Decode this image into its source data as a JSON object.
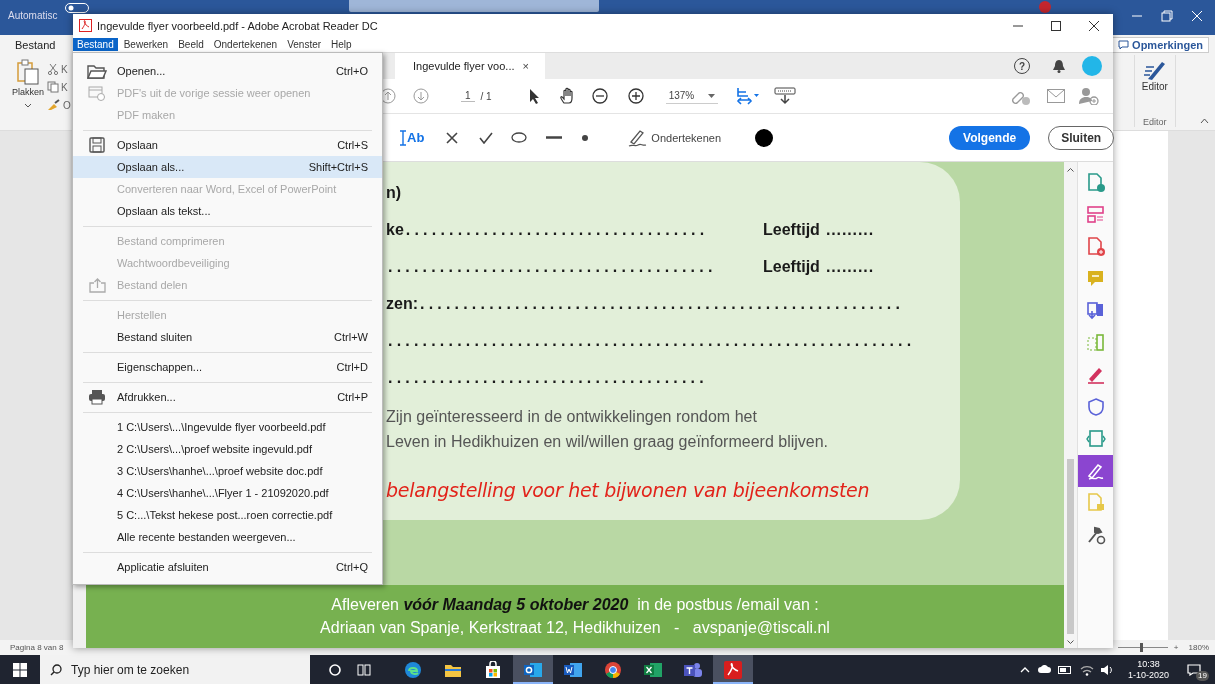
{
  "word": {
    "title_fragment": "Automatisc",
    "tab": "Bestand",
    "paste": "Plakken",
    "cut_fragment": "K",
    "copy_fragment": "K",
    "format_fragment": "O",
    "comments_button": "Opmerkingen",
    "editor_button": "Editor",
    "editor_group": "Editor",
    "status": "Pagina 8 van 8",
    "zoom": {
      "level": 0.45,
      "plus": "+",
      "reading": "180%"
    }
  },
  "acrobat": {
    "title": "Ingevulde flyer voorbeeld.pdf - Adobe Acrobat Reader DC",
    "menubar": [
      {
        "label": "Bestand",
        "selected": true
      },
      {
        "label": "Bewerken",
        "selected": false
      },
      {
        "label": "Beeld",
        "selected": false
      },
      {
        "label": "Ondertekenen",
        "selected": false
      },
      {
        "label": "Venster",
        "selected": false
      },
      {
        "label": "Help",
        "selected": false
      }
    ],
    "doc_tab": {
      "label": "Ingevulde flyer voo...",
      "close": "×"
    },
    "help": "?",
    "toolbar": {
      "page": "1",
      "page_count": "/ 1",
      "zoom": "137%"
    },
    "fill_sign": {
      "text_tool": "Ab",
      "sign": "Ondertekenen",
      "next": "Volgende",
      "close": "Sluiten"
    },
    "document": {
      "form_rows": [
        {
          "label": "n)"
        },
        {
          "label": "ke",
          "line": "...................................",
          "age_label": "Leeftijd",
          "age_line": "........."
        },
        {
          "line": "......................................",
          "age_label": "Leeftijd",
          "age_line": "........."
        },
        {
          "label": "zen:",
          "line": "........................................................"
        },
        {
          "line": "............................................................."
        },
        {
          "line": "....................................."
        }
      ],
      "note_lines": [
        "Zijn geïnteresseerd in de ontwikkelingen rondom het",
        "Leven in Hedikhuizen en wil/willen graag geïnformeerd blijven."
      ],
      "red_line": "belangstelling voor het bijwonen van bijeenkomsten",
      "footer": [
        "Afleveren **vóór Maandag 5 oktober 2020**  in de postbus /email van :",
        "Adriaan van Spanje, Kerkstraat 12, Hedikhuizen   -   avspanje@tiscali.nl"
      ]
    },
    "rail": [
      {
        "kind": "doc-badge",
        "selected": false
      },
      {
        "kind": "layout",
        "selected": false
      },
      {
        "kind": "doc-plus",
        "selected": false
      },
      {
        "kind": "comment",
        "selected": false
      },
      {
        "kind": "export",
        "selected": false
      },
      {
        "kind": "crop",
        "selected": false
      },
      {
        "kind": "pen",
        "selected": false
      },
      {
        "kind": "shield",
        "selected": false
      },
      {
        "kind": "doc-code",
        "selected": false
      },
      {
        "kind": "sign",
        "selected": true
      },
      {
        "kind": "doc-lines",
        "selected": false
      },
      {
        "kind": "wrench",
        "selected": false
      }
    ],
    "file_menu": [
      {
        "kind": "item",
        "label": "Openen...",
        "shortcut": "Ctrl+O",
        "disabled": false,
        "selected": false
      },
      {
        "kind": "item",
        "label": "PDF's uit de vorige sessie weer openen",
        "disabled": true,
        "selected": false
      },
      {
        "kind": "item",
        "label": "PDF maken",
        "disabled": true,
        "selected": false
      },
      {
        "kind": "separator"
      },
      {
        "kind": "item",
        "label": "Opslaan",
        "shortcut": "Ctrl+S",
        "disabled": false,
        "selected": false
      },
      {
        "kind": "item",
        "label": "Opslaan als...",
        "shortcut": "Shift+Ctrl+S",
        "disabled": false,
        "selected": true
      },
      {
        "kind": "item",
        "label": "Converteren naar Word, Excel of PowerPoint",
        "disabled": true,
        "selected": false
      },
      {
        "kind": "item",
        "label": "Opslaan als tekst...",
        "disabled": false,
        "selected": false
      },
      {
        "kind": "separator"
      },
      {
        "kind": "item",
        "label": "Bestand comprimeren",
        "disabled": true,
        "selected": false
      },
      {
        "kind": "item",
        "label": "Wachtwoordbeveiliging",
        "disabled": true,
        "selected": false
      },
      {
        "kind": "item",
        "label": "Bestand delen",
        "disabled": true,
        "selected": false
      },
      {
        "kind": "separator"
      },
      {
        "kind": "item",
        "label": "Herstellen",
        "disabled": true,
        "selected": false
      },
      {
        "kind": "item",
        "label": "Bestand sluiten",
        "shortcut": "Ctrl+W",
        "disabled": false,
        "selected": false
      },
      {
        "kind": "separator"
      },
      {
        "kind": "item",
        "label": "Eigenschappen...",
        "shortcut": "Ctrl+D",
        "disabled": false,
        "selected": false
      },
      {
        "kind": "separator"
      },
      {
        "kind": "item",
        "label": "Afdrukken...",
        "shortcut": "Ctrl+P",
        "disabled": false,
        "selected": false
      },
      {
        "kind": "separator"
      },
      {
        "kind": "item",
        "label": "1 C:\\Users\\...\\Ingevulde flyer voorbeeld.pdf",
        "disabled": false,
        "selected": false
      },
      {
        "kind": "item",
        "label": "2 C:\\Users\\...\\proef website ingevuld.pdf",
        "disabled": false,
        "selected": false
      },
      {
        "kind": "item",
        "label": "3 C:\\Users\\hanhe\\...\\proef website doc.pdf",
        "disabled": false,
        "selected": false
      },
      {
        "kind": "item",
        "label": "4 C:\\Users\\hanhe\\...\\Flyer 1 - 21092020.pdf",
        "disabled": false,
        "selected": false
      },
      {
        "kind": "item",
        "label": "5 C:...\\Tekst hekese post...roen correctie.pdf",
        "disabled": false,
        "selected": false
      },
      {
        "kind": "item",
        "label": "Alle recente bestanden weergeven...",
        "disabled": false,
        "selected": false
      },
      {
        "kind": "separator"
      },
      {
        "kind": "item",
        "label": "Applicatie afsluiten",
        "shortcut": "Ctrl+Q",
        "disabled": false,
        "selected": false
      }
    ]
  },
  "taskbar": {
    "search_placeholder": "Typ hier om te zoeken",
    "apps": [
      {
        "kind": "edge",
        "active": false
      },
      {
        "kind": "explorer",
        "active": false
      },
      {
        "kind": "store",
        "active": false
      },
      {
        "kind": "outlook",
        "active": true
      },
      {
        "kind": "word",
        "active": false
      },
      {
        "kind": "chrome",
        "active": false
      },
      {
        "kind": "excel",
        "active": false
      },
      {
        "kind": "teams",
        "active": false
      },
      {
        "kind": "acrobat",
        "active": true
      }
    ],
    "time": "10:38",
    "date": "1-10-2020",
    "notifications": "19"
  }
}
